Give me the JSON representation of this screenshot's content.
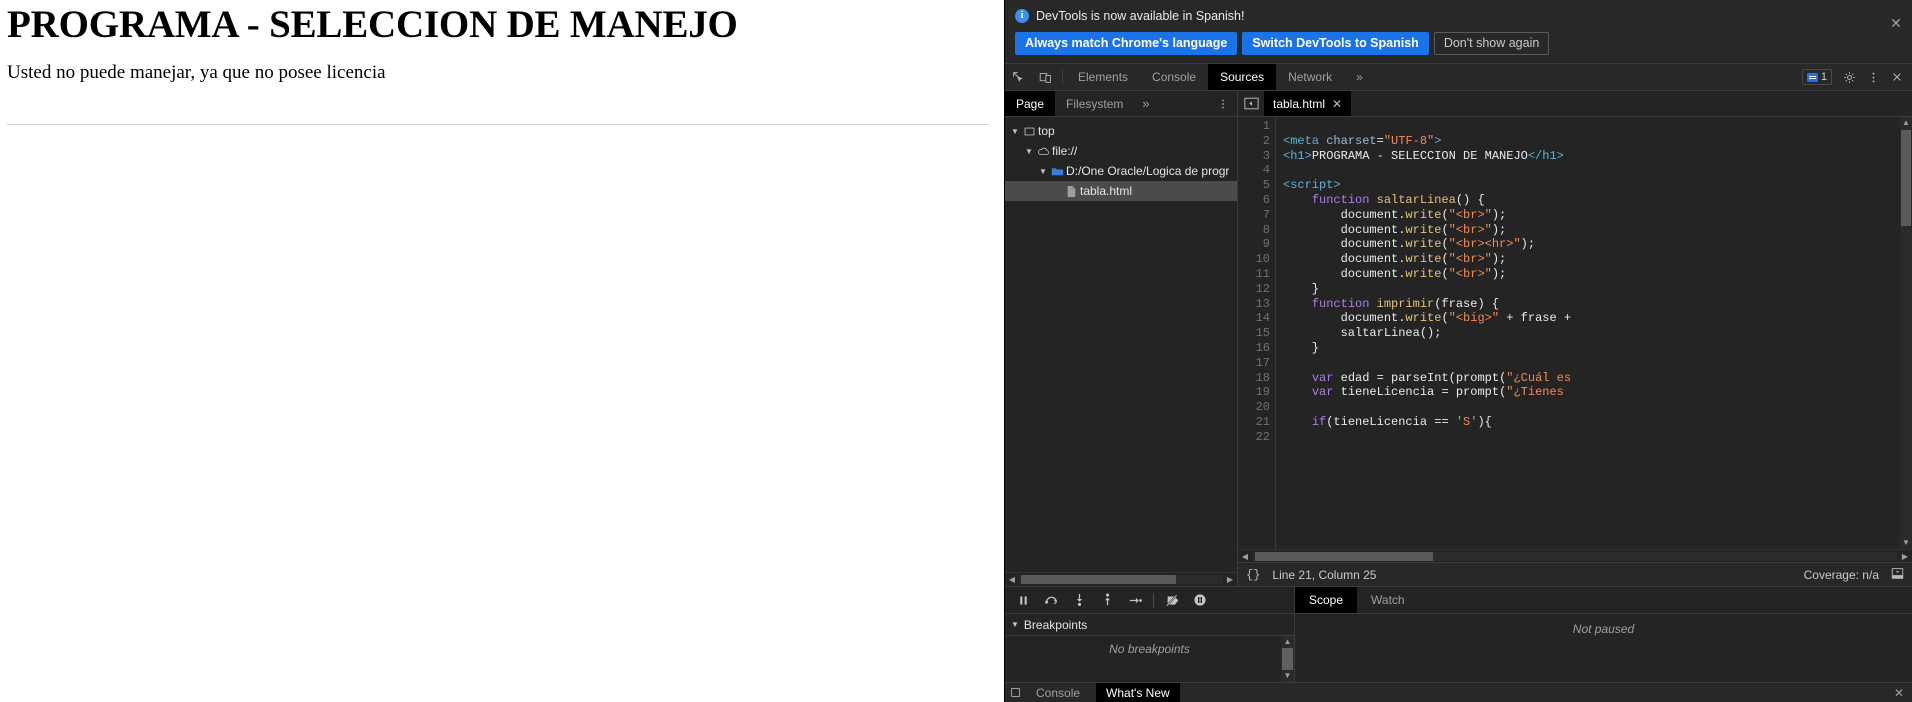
{
  "page": {
    "heading": "PROGRAMA - SELECCION DE MANEJO",
    "body_text": "Usted no puede manejar, ya que no posee licencia"
  },
  "devtools": {
    "notification": {
      "icon": "info-icon",
      "message": "DevTools is now available in Spanish!",
      "buttons": [
        {
          "label": "Always match Chrome's language",
          "style": "primary"
        },
        {
          "label": "Switch DevTools to Spanish",
          "style": "primary"
        },
        {
          "label": "Don't show again",
          "style": "secondary"
        }
      ],
      "close_label": "✕"
    },
    "toolbar": {
      "inspect_icon": "inspect-element-icon",
      "device_icon": "device-toolbar-icon",
      "tabs": [
        {
          "label": "Elements",
          "active": false
        },
        {
          "label": "Console",
          "active": false
        },
        {
          "label": "Sources",
          "active": true
        },
        {
          "label": "Network",
          "active": false
        }
      ],
      "more_tabs_label": "»",
      "issues_count": "1",
      "settings_icon": "gear-icon",
      "more_options_icon": "kebab-menu-icon",
      "close_icon": "close-icon"
    },
    "navigator": {
      "tabs": [
        {
          "label": "Page",
          "active": true
        },
        {
          "label": "Filesystem",
          "active": false
        }
      ],
      "more_label": "»",
      "menu_icon": "kebab-menu-icon",
      "tree": [
        {
          "label": "top",
          "icon": "frame-icon",
          "indent": 0,
          "expanded": true,
          "selected": false
        },
        {
          "label": "file://",
          "icon": "cloud-icon",
          "indent": 1,
          "expanded": true,
          "selected": false
        },
        {
          "label": "D:/One Oracle/Logica de progr",
          "icon": "folder-icon",
          "indent": 2,
          "expanded": true,
          "selected": false
        },
        {
          "label": "tabla.html",
          "icon": "file-icon",
          "indent": 3,
          "expanded": null,
          "selected": true
        }
      ]
    },
    "editor": {
      "panel_toggle_icon": "show-navigator-icon",
      "tab_name": "tabla.html",
      "tab_close_label": "✕",
      "line_numbers": [
        "1",
        "2",
        "3",
        "4",
        "5",
        "6",
        "7",
        "8",
        "9",
        "10",
        "11",
        "12",
        "13",
        "14",
        "15",
        "16",
        "17",
        "18",
        "19",
        "20",
        "21",
        "22"
      ],
      "code_lines": [
        [],
        [
          {
            "t": "<",
            "c": "k-tag"
          },
          {
            "t": "meta",
            "c": "k-tag"
          },
          {
            "t": " ",
            "c": "k-plain"
          },
          {
            "t": "charset",
            "c": "k-attr"
          },
          {
            "t": "=",
            "c": "k-plain"
          },
          {
            "t": "\"UTF-8\"",
            "c": "k-str"
          },
          {
            "t": ">",
            "c": "k-tag"
          }
        ],
        [
          {
            "t": "<h1>",
            "c": "k-tag"
          },
          {
            "t": "PROGRAMA - SELECCION DE MANEJO",
            "c": "k-plain"
          },
          {
            "t": "</h1>",
            "c": "k-tag"
          }
        ],
        [],
        [
          {
            "t": "<script>",
            "c": "k-tag"
          }
        ],
        [
          {
            "t": "    ",
            "c": "k-plain"
          },
          {
            "t": "function",
            "c": "k-kw"
          },
          {
            "t": " ",
            "c": "k-plain"
          },
          {
            "t": "saltarLinea",
            "c": "k-fn"
          },
          {
            "t": "() {",
            "c": "k-plain"
          }
        ],
        [
          {
            "t": "        document.",
            "c": "k-plain"
          },
          {
            "t": "write",
            "c": "k-fn"
          },
          {
            "t": "(",
            "c": "k-plain"
          },
          {
            "t": "\"<br>\"",
            "c": "k-str"
          },
          {
            "t": ");",
            "c": "k-plain"
          }
        ],
        [
          {
            "t": "        document.",
            "c": "k-plain"
          },
          {
            "t": "write",
            "c": "k-fn"
          },
          {
            "t": "(",
            "c": "k-plain"
          },
          {
            "t": "\"<br>\"",
            "c": "k-str"
          },
          {
            "t": ");",
            "c": "k-plain"
          }
        ],
        [
          {
            "t": "        document.",
            "c": "k-plain"
          },
          {
            "t": "write",
            "c": "k-fn"
          },
          {
            "t": "(",
            "c": "k-plain"
          },
          {
            "t": "\"<br><hr>\"",
            "c": "k-str"
          },
          {
            "t": ");",
            "c": "k-plain"
          }
        ],
        [
          {
            "t": "        document.",
            "c": "k-plain"
          },
          {
            "t": "write",
            "c": "k-fn"
          },
          {
            "t": "(",
            "c": "k-plain"
          },
          {
            "t": "\"<br>\"",
            "c": "k-str"
          },
          {
            "t": ");",
            "c": "k-plain"
          }
        ],
        [
          {
            "t": "        document.",
            "c": "k-plain"
          },
          {
            "t": "write",
            "c": "k-fn"
          },
          {
            "t": "(",
            "c": "k-plain"
          },
          {
            "t": "\"<br>\"",
            "c": "k-str"
          },
          {
            "t": ");",
            "c": "k-plain"
          }
        ],
        [
          {
            "t": "    }",
            "c": "k-plain"
          }
        ],
        [
          {
            "t": "    ",
            "c": "k-plain"
          },
          {
            "t": "function",
            "c": "k-kw"
          },
          {
            "t": " ",
            "c": "k-plain"
          },
          {
            "t": "imprimir",
            "c": "k-fn"
          },
          {
            "t": "(frase) {",
            "c": "k-plain"
          }
        ],
        [
          {
            "t": "        document.",
            "c": "k-plain"
          },
          {
            "t": "write",
            "c": "k-fn"
          },
          {
            "t": "(",
            "c": "k-plain"
          },
          {
            "t": "\"<big>\"",
            "c": "k-str"
          },
          {
            "t": " + frase + ",
            "c": "k-plain"
          }
        ],
        [
          {
            "t": "        ",
            "c": "k-plain"
          },
          {
            "t": "saltarLinea",
            "c": "k-plain"
          },
          {
            "t": "();",
            "c": "k-plain"
          }
        ],
        [
          {
            "t": "    }",
            "c": "k-plain"
          }
        ],
        [],
        [
          {
            "t": "    ",
            "c": "k-plain"
          },
          {
            "t": "var",
            "c": "k-kw"
          },
          {
            "t": " edad = ",
            "c": "k-plain"
          },
          {
            "t": "parseInt",
            "c": "k-plain"
          },
          {
            "t": "(",
            "c": "k-plain"
          },
          {
            "t": "prompt",
            "c": "k-plain"
          },
          {
            "t": "(",
            "c": "k-plain"
          },
          {
            "t": "\"¿Cuál es",
            "c": "k-str"
          }
        ],
        [
          {
            "t": "    ",
            "c": "k-plain"
          },
          {
            "t": "var",
            "c": "k-kw"
          },
          {
            "t": " tieneLicencia = ",
            "c": "k-plain"
          },
          {
            "t": "prompt",
            "c": "k-plain"
          },
          {
            "t": "(",
            "c": "k-plain"
          },
          {
            "t": "\"¿Tienes ",
            "c": "k-str"
          }
        ],
        [],
        [
          {
            "t": "    ",
            "c": "k-plain"
          },
          {
            "t": "if",
            "c": "k-kw"
          },
          {
            "t": "(tieneLicencia == ",
            "c": "k-plain"
          },
          {
            "t": "'S'",
            "c": "k-str"
          },
          {
            "t": "){",
            "c": "k-plain"
          }
        ],
        []
      ],
      "status": {
        "format_icon": "{}",
        "cursor_position": "Line 21, Column 25",
        "coverage": "Coverage: n/a",
        "drawer_icon": "show-drawer-icon"
      }
    },
    "debugger": {
      "controls": [
        {
          "icon": "pause-script-icon",
          "name": "pause-resume-button"
        },
        {
          "icon": "step-over-icon",
          "name": "step-over-button"
        },
        {
          "icon": "step-into-icon",
          "name": "step-into-button"
        },
        {
          "icon": "step-out-icon",
          "name": "step-out-button"
        },
        {
          "icon": "step-icon",
          "name": "step-button"
        },
        {
          "icon": "deactivate-breakpoints-icon",
          "name": "deactivate-breakpoints-button"
        },
        {
          "icon": "pause-on-exceptions-icon",
          "name": "pause-on-exceptions-button"
        }
      ],
      "breakpoints": {
        "section_title": "Breakpoints",
        "empty_text": "No breakpoints",
        "expanded": true
      },
      "side_tabs": [
        {
          "label": "Scope",
          "active": true
        },
        {
          "label": "Watch",
          "active": false
        }
      ],
      "scope_empty_text": "Not paused"
    },
    "drawer": {
      "tabs": [
        {
          "label": "Console",
          "active": false
        },
        {
          "label": "What's New",
          "active": true
        }
      ],
      "close_label": "✕"
    }
  }
}
